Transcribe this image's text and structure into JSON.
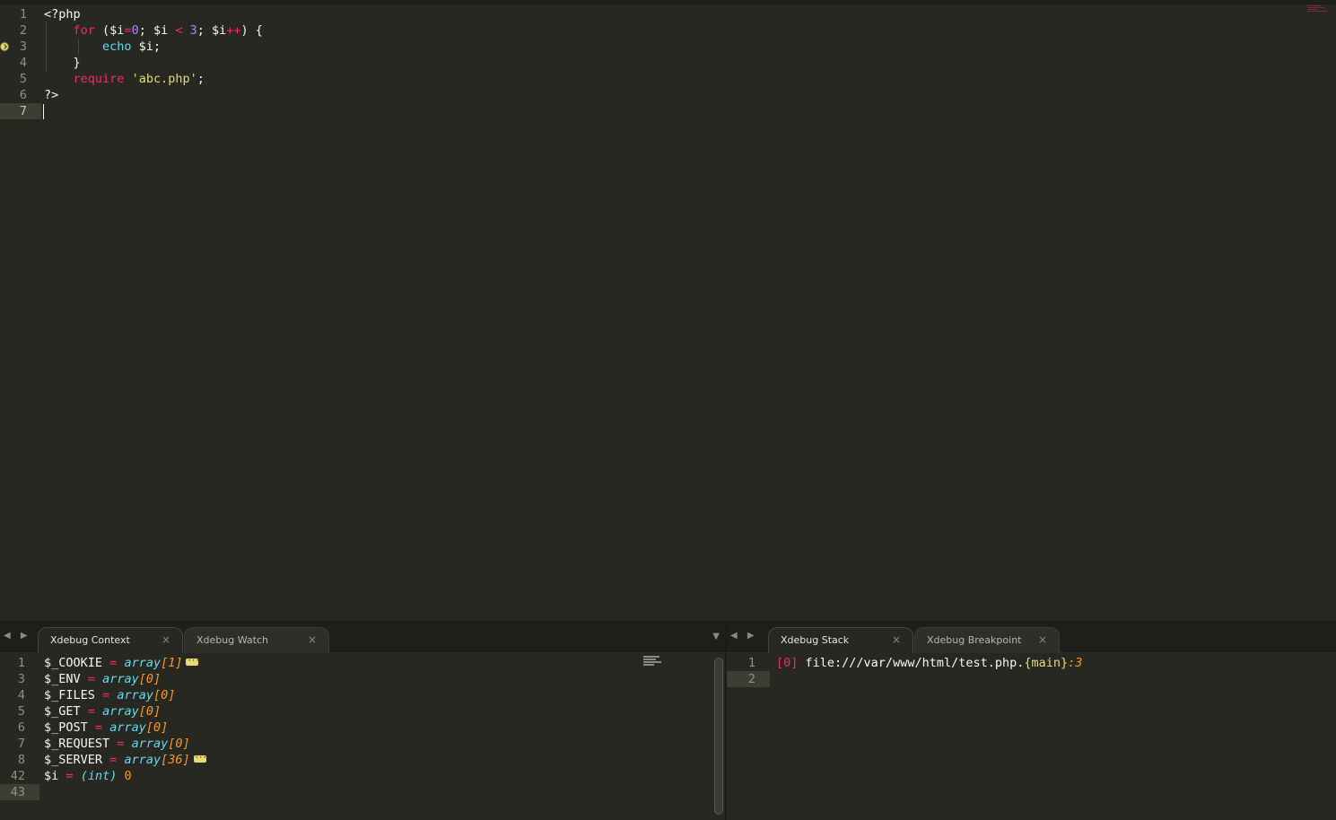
{
  "editor": {
    "lines": [
      {
        "num": "1",
        "tokens": [
          {
            "t": "<?php",
            "c": ""
          }
        ]
      },
      {
        "num": "2",
        "tokens": [
          {
            "t": "    ",
            "c": ""
          },
          {
            "t": "for",
            "c": "kw"
          },
          {
            "t": " ($i",
            "c": ""
          },
          {
            "t": "=",
            "c": "op"
          },
          {
            "t": "0",
            "c": "num"
          },
          {
            "t": "; $i ",
            "c": ""
          },
          {
            "t": "<",
            "c": "op"
          },
          {
            "t": " ",
            "c": ""
          },
          {
            "t": "3",
            "c": "num"
          },
          {
            "t": "; $i",
            "c": ""
          },
          {
            "t": "++",
            "c": "op"
          },
          {
            "t": ") {",
            "c": ""
          }
        ]
      },
      {
        "num": "3",
        "tokens": [
          {
            "t": "        ",
            "c": ""
          },
          {
            "t": "echo",
            "c": "fn"
          },
          {
            "t": " $i;",
            "c": ""
          }
        ]
      },
      {
        "num": "4",
        "tokens": [
          {
            "t": "    }",
            "c": ""
          }
        ]
      },
      {
        "num": "5",
        "tokens": [
          {
            "t": "    ",
            "c": ""
          },
          {
            "t": "require",
            "c": "kw"
          },
          {
            "t": " ",
            "c": ""
          },
          {
            "t": "'abc.php'",
            "c": "str"
          },
          {
            "t": ";",
            "c": ""
          }
        ]
      },
      {
        "num": "6",
        "tokens": [
          {
            "t": "?>",
            "c": ""
          }
        ]
      },
      {
        "num": "7",
        "tokens": []
      }
    ],
    "breakpoint_line": "3",
    "current_line": "7"
  },
  "left_panel": {
    "tabs": [
      {
        "label": "Xdebug Context",
        "active": true
      },
      {
        "label": "Xdebug Watch",
        "active": false
      }
    ],
    "close_glyph": "×",
    "nav_glyph": "◀ ▶",
    "menu_glyph": "▼",
    "lines": [
      {
        "num": "1",
        "name": "$_COOKIE",
        "eq": "=",
        "type": "array",
        "count": "[1]",
        "expandable": true
      },
      {
        "num": "3",
        "name": "$_ENV",
        "eq": "=",
        "type": "array",
        "count": "[0]",
        "expandable": false
      },
      {
        "num": "4",
        "name": "$_FILES",
        "eq": "=",
        "type": "array",
        "count": "[0]",
        "expandable": false
      },
      {
        "num": "5",
        "name": "$_GET",
        "eq": "=",
        "type": "array",
        "count": "[0]",
        "expandable": false
      },
      {
        "num": "6",
        "name": "$_POST",
        "eq": "=",
        "type": "array",
        "count": "[0]",
        "expandable": false
      },
      {
        "num": "7",
        "name": "$_REQUEST",
        "eq": "=",
        "type": "array",
        "count": "[0]",
        "expandable": false
      },
      {
        "num": "8",
        "name": "$_SERVER",
        "eq": "=",
        "type": "array",
        "count": "[36]",
        "expandable": true
      },
      {
        "num": "42",
        "name": "$i",
        "eq": "=",
        "type": "(int)",
        "count": "0",
        "expandable": false,
        "int": true
      },
      {
        "num": "43",
        "name": "",
        "eq": "",
        "type": "",
        "count": "",
        "expandable": false
      }
    ]
  },
  "right_panel": {
    "tabs": [
      {
        "label": "Xdebug Stack",
        "active": true
      },
      {
        "label": "Xdebug Breakpoint",
        "active": false
      }
    ],
    "lines": [
      {
        "num": "1",
        "index": "[0]",
        "file": "file:///var/www/html/test.php.",
        "func": "{main}",
        "line": ":3"
      },
      {
        "num": "2",
        "index": "",
        "file": "",
        "func": "",
        "line": ""
      }
    ]
  },
  "colors": {
    "background": "#272822",
    "keyword": "#f92672",
    "function": "#66d9ef",
    "number": "#ae81ff",
    "string": "#e6db74",
    "count": "#fd971f"
  }
}
